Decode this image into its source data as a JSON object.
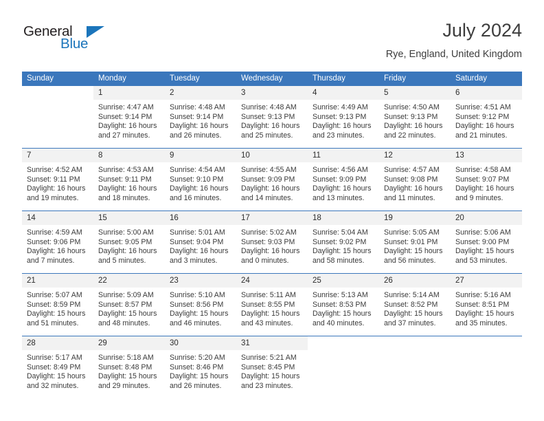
{
  "brand": {
    "name_part1": "General",
    "name_part2": "Blue"
  },
  "header": {
    "title": "July 2024",
    "location": "Rye, England, United Kingdom"
  },
  "weekday_headers": [
    "Sunday",
    "Monday",
    "Tuesday",
    "Wednesday",
    "Thursday",
    "Friday",
    "Saturday"
  ],
  "colors": {
    "header_blue": "#3b77bc",
    "daynum_band": "#f2f2f2",
    "logo_blue": "#1b75bb",
    "text": "#3a3a3a"
  },
  "weeks": [
    [
      {
        "day": "",
        "lines": []
      },
      {
        "day": "1",
        "lines": [
          "Sunrise: 4:47 AM",
          "Sunset: 9:14 PM",
          "Daylight: 16 hours",
          "and 27 minutes."
        ]
      },
      {
        "day": "2",
        "lines": [
          "Sunrise: 4:48 AM",
          "Sunset: 9:14 PM",
          "Daylight: 16 hours",
          "and 26 minutes."
        ]
      },
      {
        "day": "3",
        "lines": [
          "Sunrise: 4:48 AM",
          "Sunset: 9:13 PM",
          "Daylight: 16 hours",
          "and 25 minutes."
        ]
      },
      {
        "day": "4",
        "lines": [
          "Sunrise: 4:49 AM",
          "Sunset: 9:13 PM",
          "Daylight: 16 hours",
          "and 23 minutes."
        ]
      },
      {
        "day": "5",
        "lines": [
          "Sunrise: 4:50 AM",
          "Sunset: 9:13 PM",
          "Daylight: 16 hours",
          "and 22 minutes."
        ]
      },
      {
        "day": "6",
        "lines": [
          "Sunrise: 4:51 AM",
          "Sunset: 9:12 PM",
          "Daylight: 16 hours",
          "and 21 minutes."
        ]
      }
    ],
    [
      {
        "day": "7",
        "lines": [
          "Sunrise: 4:52 AM",
          "Sunset: 9:11 PM",
          "Daylight: 16 hours",
          "and 19 minutes."
        ]
      },
      {
        "day": "8",
        "lines": [
          "Sunrise: 4:53 AM",
          "Sunset: 9:11 PM",
          "Daylight: 16 hours",
          "and 18 minutes."
        ]
      },
      {
        "day": "9",
        "lines": [
          "Sunrise: 4:54 AM",
          "Sunset: 9:10 PM",
          "Daylight: 16 hours",
          "and 16 minutes."
        ]
      },
      {
        "day": "10",
        "lines": [
          "Sunrise: 4:55 AM",
          "Sunset: 9:09 PM",
          "Daylight: 16 hours",
          "and 14 minutes."
        ]
      },
      {
        "day": "11",
        "lines": [
          "Sunrise: 4:56 AM",
          "Sunset: 9:09 PM",
          "Daylight: 16 hours",
          "and 13 minutes."
        ]
      },
      {
        "day": "12",
        "lines": [
          "Sunrise: 4:57 AM",
          "Sunset: 9:08 PM",
          "Daylight: 16 hours",
          "and 11 minutes."
        ]
      },
      {
        "day": "13",
        "lines": [
          "Sunrise: 4:58 AM",
          "Sunset: 9:07 PM",
          "Daylight: 16 hours",
          "and 9 minutes."
        ]
      }
    ],
    [
      {
        "day": "14",
        "lines": [
          "Sunrise: 4:59 AM",
          "Sunset: 9:06 PM",
          "Daylight: 16 hours",
          "and 7 minutes."
        ]
      },
      {
        "day": "15",
        "lines": [
          "Sunrise: 5:00 AM",
          "Sunset: 9:05 PM",
          "Daylight: 16 hours",
          "and 5 minutes."
        ]
      },
      {
        "day": "16",
        "lines": [
          "Sunrise: 5:01 AM",
          "Sunset: 9:04 PM",
          "Daylight: 16 hours",
          "and 3 minutes."
        ]
      },
      {
        "day": "17",
        "lines": [
          "Sunrise: 5:02 AM",
          "Sunset: 9:03 PM",
          "Daylight: 16 hours",
          "and 0 minutes."
        ]
      },
      {
        "day": "18",
        "lines": [
          "Sunrise: 5:04 AM",
          "Sunset: 9:02 PM",
          "Daylight: 15 hours",
          "and 58 minutes."
        ]
      },
      {
        "day": "19",
        "lines": [
          "Sunrise: 5:05 AM",
          "Sunset: 9:01 PM",
          "Daylight: 15 hours",
          "and 56 minutes."
        ]
      },
      {
        "day": "20",
        "lines": [
          "Sunrise: 5:06 AM",
          "Sunset: 9:00 PM",
          "Daylight: 15 hours",
          "and 53 minutes."
        ]
      }
    ],
    [
      {
        "day": "21",
        "lines": [
          "Sunrise: 5:07 AM",
          "Sunset: 8:59 PM",
          "Daylight: 15 hours",
          "and 51 minutes."
        ]
      },
      {
        "day": "22",
        "lines": [
          "Sunrise: 5:09 AM",
          "Sunset: 8:57 PM",
          "Daylight: 15 hours",
          "and 48 minutes."
        ]
      },
      {
        "day": "23",
        "lines": [
          "Sunrise: 5:10 AM",
          "Sunset: 8:56 PM",
          "Daylight: 15 hours",
          "and 46 minutes."
        ]
      },
      {
        "day": "24",
        "lines": [
          "Sunrise: 5:11 AM",
          "Sunset: 8:55 PM",
          "Daylight: 15 hours",
          "and 43 minutes."
        ]
      },
      {
        "day": "25",
        "lines": [
          "Sunrise: 5:13 AM",
          "Sunset: 8:53 PM",
          "Daylight: 15 hours",
          "and 40 minutes."
        ]
      },
      {
        "day": "26",
        "lines": [
          "Sunrise: 5:14 AM",
          "Sunset: 8:52 PM",
          "Daylight: 15 hours",
          "and 37 minutes."
        ]
      },
      {
        "day": "27",
        "lines": [
          "Sunrise: 5:16 AM",
          "Sunset: 8:51 PM",
          "Daylight: 15 hours",
          "and 35 minutes."
        ]
      }
    ],
    [
      {
        "day": "28",
        "lines": [
          "Sunrise: 5:17 AM",
          "Sunset: 8:49 PM",
          "Daylight: 15 hours",
          "and 32 minutes."
        ]
      },
      {
        "day": "29",
        "lines": [
          "Sunrise: 5:18 AM",
          "Sunset: 8:48 PM",
          "Daylight: 15 hours",
          "and 29 minutes."
        ]
      },
      {
        "day": "30",
        "lines": [
          "Sunrise: 5:20 AM",
          "Sunset: 8:46 PM",
          "Daylight: 15 hours",
          "and 26 minutes."
        ]
      },
      {
        "day": "31",
        "lines": [
          "Sunrise: 5:21 AM",
          "Sunset: 8:45 PM",
          "Daylight: 15 hours",
          "and 23 minutes."
        ]
      },
      {
        "day": "",
        "lines": []
      },
      {
        "day": "",
        "lines": []
      },
      {
        "day": "",
        "lines": []
      }
    ]
  ]
}
